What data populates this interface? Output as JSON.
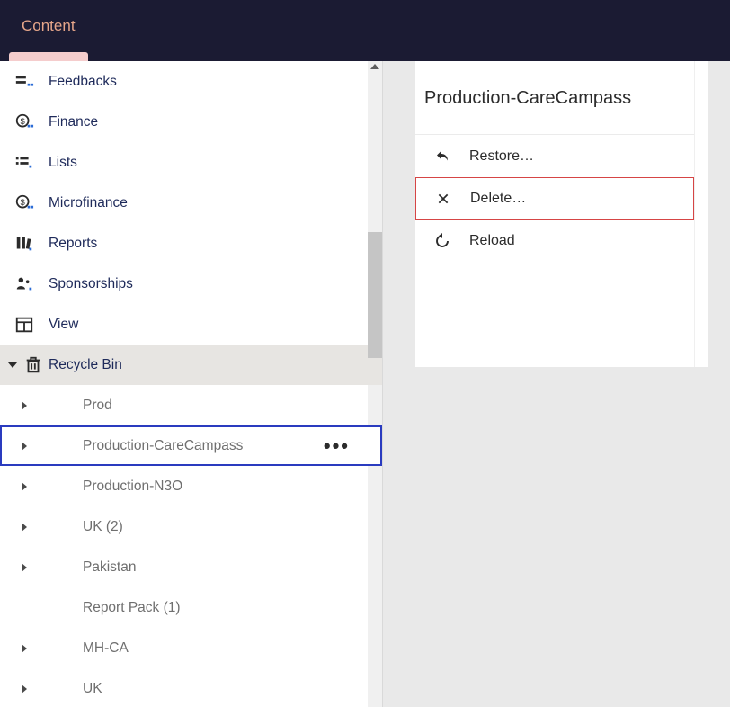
{
  "topbar": {
    "tab_content": "Content"
  },
  "tree": {
    "items": [
      {
        "label": "Feedbacks"
      },
      {
        "label": "Finance"
      },
      {
        "label": "Lists"
      },
      {
        "label": "Microfinance"
      },
      {
        "label": "Reports"
      },
      {
        "label": "Sponsorships"
      },
      {
        "label": "View"
      }
    ],
    "recycle_bin": {
      "label": "Recycle Bin",
      "children": [
        {
          "label": "Prod",
          "has_children": true
        },
        {
          "label": "Production-CareCampass",
          "has_children": true,
          "selected": true
        },
        {
          "label": "Production-N3O",
          "has_children": true
        },
        {
          "label": "UK (2)",
          "has_children": true
        },
        {
          "label": "Pakistan",
          "has_children": true
        },
        {
          "label": "Report Pack (1)",
          "has_children": false
        },
        {
          "label": "MH-CA",
          "has_children": true
        },
        {
          "label": "UK",
          "has_children": true
        }
      ]
    }
  },
  "actions": {
    "title": "Production-CareCampass",
    "items": [
      {
        "label": "Restore…"
      },
      {
        "label": "Delete…",
        "highlight": true
      },
      {
        "label": "Reload"
      }
    ]
  }
}
